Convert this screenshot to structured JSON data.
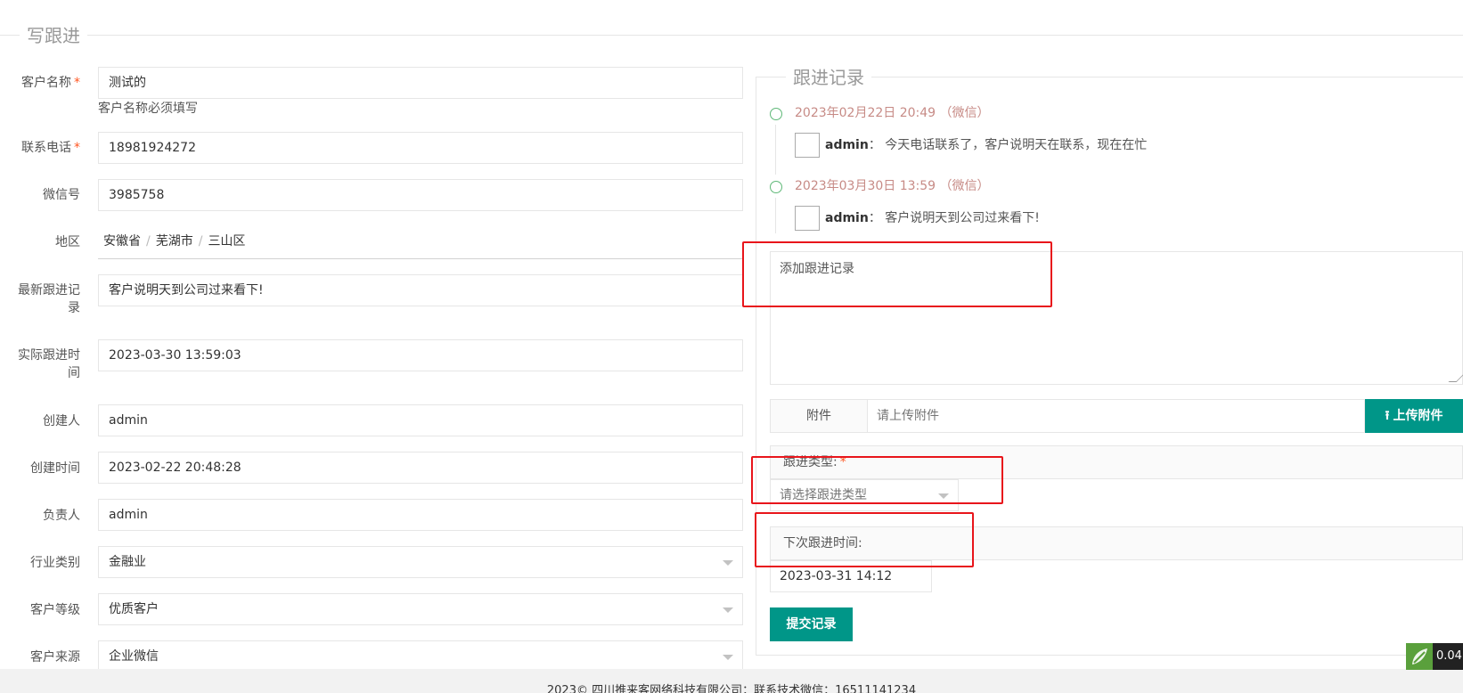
{
  "section_title": "写跟进",
  "form": {
    "customer_name": {
      "label": "客户名称",
      "value": "测试的",
      "hint": "客户名称必须填写"
    },
    "phone": {
      "label": "联系电话",
      "value": "18981924272"
    },
    "wechat": {
      "label": "微信号",
      "value": "3985758"
    },
    "region": {
      "label": "地区",
      "province": "安徽省",
      "city": "芜湖市",
      "district": "三山区",
      "separator": "/"
    },
    "latest_followup": {
      "label_line1": "最新跟进记",
      "label_line2": "录",
      "value": "客户说明天到公司过来看下!"
    },
    "actual_time": {
      "label_line1": "实际跟进时",
      "label_line2": "间",
      "value": "2023-03-30 13:59:03"
    },
    "creator": {
      "label": "创建人",
      "value": "admin"
    },
    "created_time": {
      "label": "创建时间",
      "value": "2023-02-22 20:48:28"
    },
    "owner": {
      "label": "负责人",
      "value": "admin"
    },
    "industry": {
      "label": "行业类别",
      "value": "金融业"
    },
    "level": {
      "label": "客户等级",
      "value": "优质客户"
    },
    "source": {
      "label": "客户来源",
      "value": "企业微信"
    }
  },
  "records": {
    "title": "跟进记录",
    "items": [
      {
        "time": "2023年02月22日 20:49 （微信）",
        "user": "admin",
        "sep": "：",
        "content": "今天电话联系了，客户说明天在联系，现在在忙"
      },
      {
        "time": "2023年03月30日 13:59 （微信）",
        "user": "admin",
        "sep": "：",
        "content": "客户说明天到公司过来看下!"
      }
    ],
    "textarea_placeholder": "添加跟进记录",
    "attachment_label": "附件",
    "attachment_placeholder": "请上传附件",
    "upload_button": "上传附件",
    "type_label": "跟进类型:",
    "type_placeholder": "请选择跟进类型",
    "next_time_label": "下次跟进时间:",
    "next_time_value": "2023-03-31 14:12",
    "submit_button": "提交记录"
  },
  "footer": "2023© 四川推来客网络科技有限公司：联系技术微信：16511141234",
  "perf_value": "0.043",
  "colors": {
    "accent": "#009688",
    "timeline_dot": "#5FB878",
    "timeline_time": "#c78b86",
    "required": "#ff5722",
    "annotation_box": "#e8151b"
  }
}
